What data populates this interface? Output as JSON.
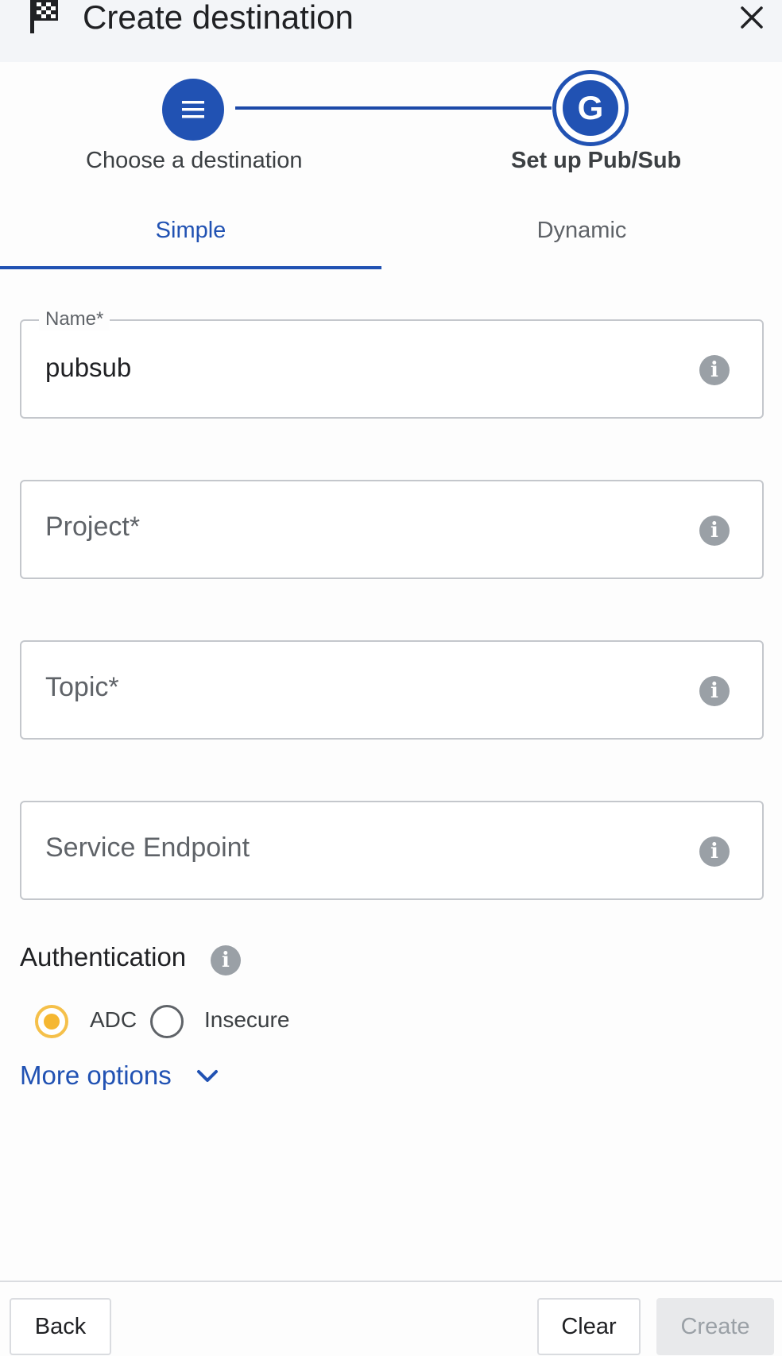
{
  "header": {
    "title": "Create destination",
    "icon": "checkered-flag-icon",
    "close_icon": "close-icon"
  },
  "stepper": {
    "steps": [
      {
        "label": "Choose a destination",
        "icon": "list-icon",
        "state": "completed"
      },
      {
        "label": "Set up Pub/Sub",
        "icon_letter": "G",
        "state": "active"
      }
    ]
  },
  "tabs": [
    {
      "label": "Simple",
      "selected": true
    },
    {
      "label": "Dynamic",
      "selected": false
    }
  ],
  "fields": {
    "name": {
      "label": "Name*",
      "value": "pubsub"
    },
    "project": {
      "placeholder": "Project*",
      "value": ""
    },
    "topic": {
      "placeholder": "Topic*",
      "value": ""
    },
    "service_endpoint": {
      "placeholder": "Service Endpoint",
      "value": ""
    }
  },
  "authentication": {
    "title": "Authentication",
    "options": [
      {
        "label": "ADC",
        "selected": true
      },
      {
        "label": "Insecure",
        "selected": false
      }
    ]
  },
  "more_options": {
    "label": "More options",
    "icon": "chevron-down-icon"
  },
  "footer": {
    "back_label": "Back",
    "clear_label": "Clear",
    "create_label": "Create",
    "create_enabled": false
  },
  "colors": {
    "accent": "#2152b3",
    "radio_selected": "#f5b731",
    "info_icon": "#9aa0a6",
    "header_bg": "#f3f5f8"
  }
}
